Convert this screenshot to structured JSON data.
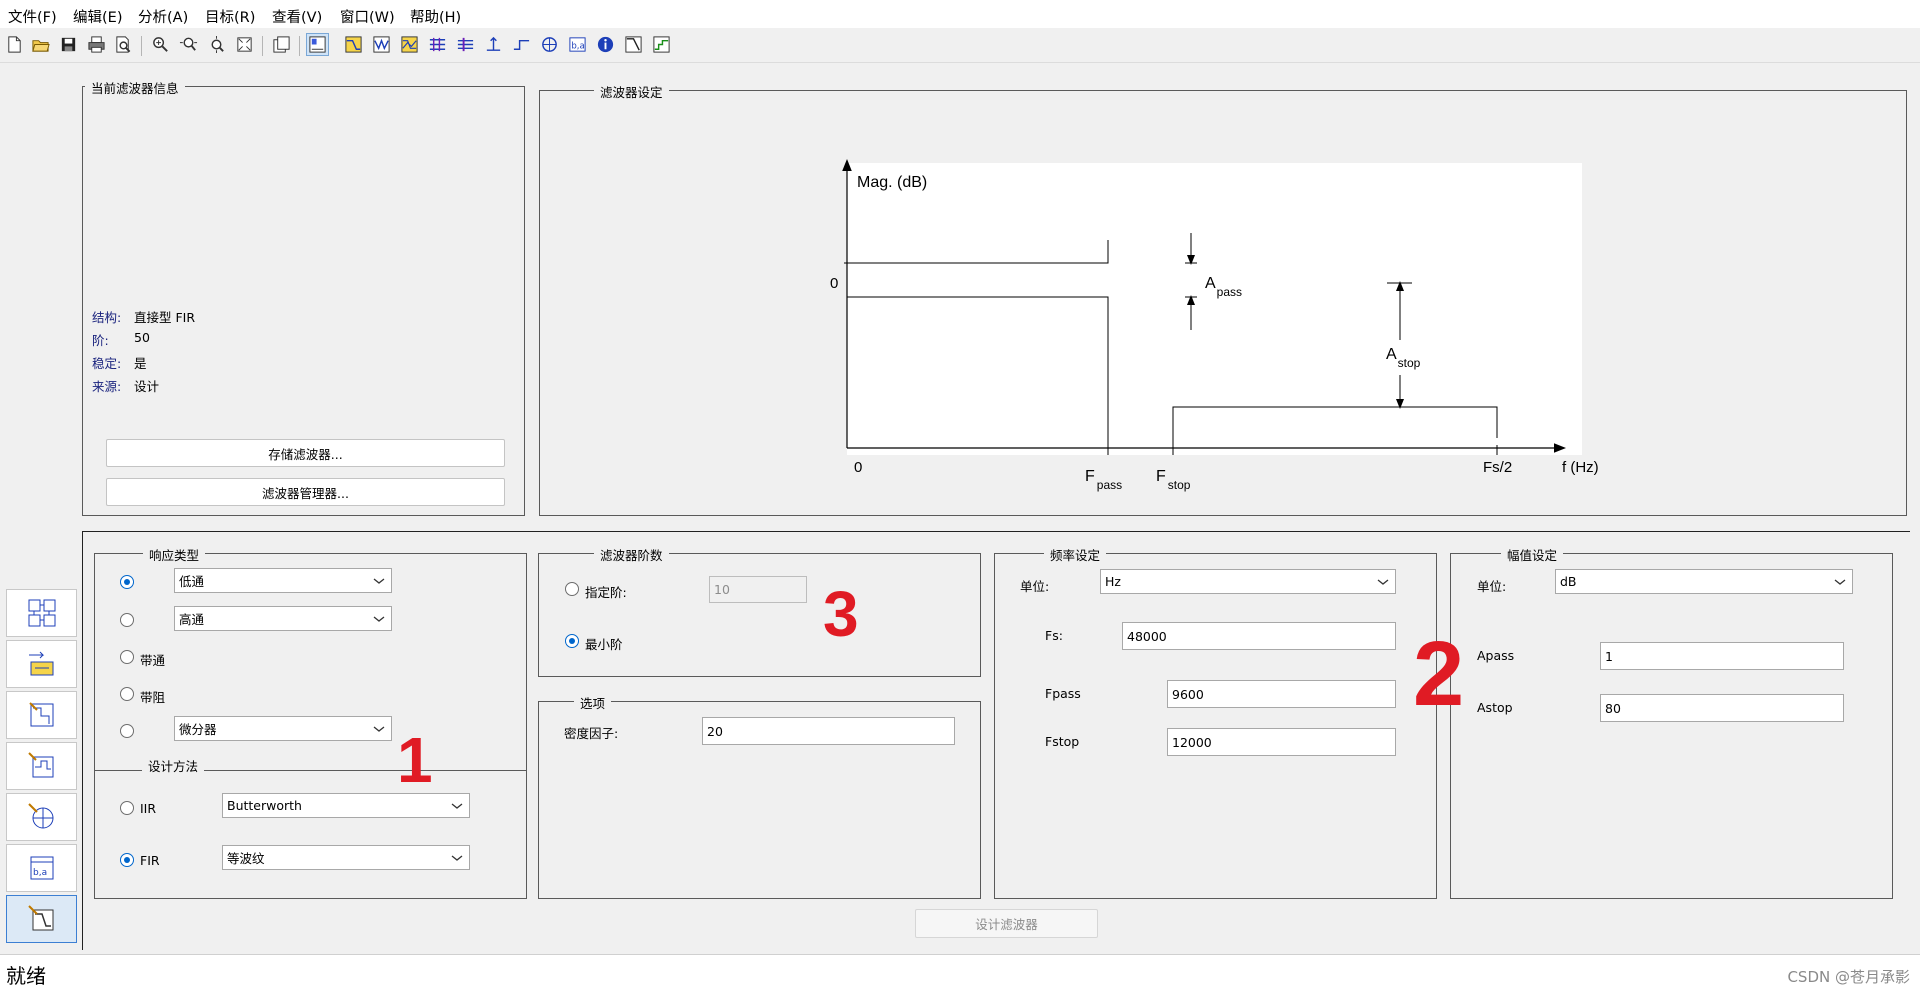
{
  "menu": [
    "文件(F)",
    "编辑(E)",
    "分析(A)",
    "目标(R)",
    "查看(V)",
    "窗口(W)",
    "帮助(H)"
  ],
  "current_filter": {
    "title": "当前滤波器信息",
    "rows": [
      {
        "key": "结构:",
        "value": "直接型 FIR"
      },
      {
        "key": "阶:",
        "value": "50"
      },
      {
        "key": "稳定:",
        "value": "是"
      },
      {
        "key": "来源:",
        "value": "设计"
      }
    ],
    "store_button": "存储滤波器...",
    "manager_button": "滤波器管理器..."
  },
  "filter_spec": {
    "title": "滤波器设定",
    "diagram": {
      "ylabel": "Mag. (dB)",
      "zero_y": "0",
      "zero_x": "0",
      "fpass_main": "F",
      "fpass_sub": "pass",
      "fstop_main": "F",
      "fstop_sub": "stop",
      "fs2": "Fs/2",
      "xlabel": "f (Hz)",
      "apass_main": "A",
      "apass_sub": "pass",
      "astop_main": "A",
      "astop_sub": "stop"
    }
  },
  "response_type": {
    "title": "响应类型",
    "lowpass": "低通",
    "highpass": "高通",
    "bandpass": "带通",
    "bandstop": "带阻",
    "differentiator": "微分器"
  },
  "design_method": {
    "title": "设计方法",
    "iir_label": "IIR",
    "iir_value": "Butterworth",
    "fir_label": "FIR",
    "fir_value": "等波纹"
  },
  "filter_order": {
    "title": "滤波器阶数",
    "specify_label": "指定阶:",
    "specify_value": "10",
    "minimum_label": "最小阶"
  },
  "options": {
    "title": "选项",
    "density_label": "密度因子:",
    "density_value": "20"
  },
  "freq_spec": {
    "title": "频率设定",
    "unit_label": "单位:",
    "unit_value": "Hz",
    "fs_label": "Fs:",
    "fs_value": "48000",
    "fpass_label": "Fpass",
    "fpass_value": "9600",
    "fstop_label": "Fstop",
    "fstop_value": "12000"
  },
  "mag_spec": {
    "title": "幅值设定",
    "unit_label": "单位:",
    "unit_value": "dB",
    "apass_label": "Apass",
    "apass_value": "1",
    "astop_label": "Astop",
    "astop_value": "80"
  },
  "design_button": "设计滤波器",
  "annotations": [
    "1",
    "2",
    "3"
  ],
  "status": {
    "text": "就绪",
    "watermark": "CSDN @苍月承影"
  }
}
